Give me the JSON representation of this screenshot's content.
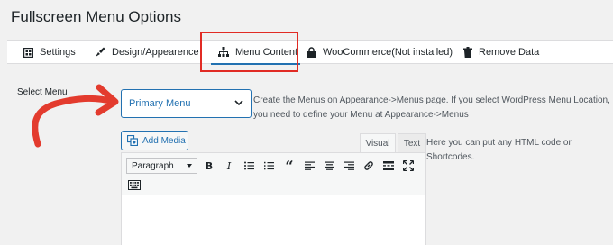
{
  "page": {
    "title": "Fullscreen Menu Options"
  },
  "tabs": [
    {
      "label": "Settings",
      "icon": "settings-grid-icon"
    },
    {
      "label": "Design/Appearence",
      "icon": "brush-icon"
    },
    {
      "label": "Menu Content",
      "icon": "sitemap-icon"
    },
    {
      "label": "WooCommerce(Not installed)",
      "icon": "lock-icon"
    },
    {
      "label": "Remove Data",
      "icon": "trash-icon"
    }
  ],
  "form": {
    "select_label": "Select Menu",
    "select_value": "Primary Menu",
    "help_text": "Create the Menus on Appearance->Menus page. If you select WordPress Menu Location, you need to define your Menu at Appearance->Menus",
    "editor_help": "Here you can put any HTML code or Shortcodes."
  },
  "editor": {
    "add_media": "Add Media",
    "tab_visual": "Visual",
    "tab_text": "Text",
    "format": "Paragraph",
    "toolbar_icons": [
      "bold-icon",
      "italic-icon",
      "bullet-list-icon",
      "numbered-list-icon",
      "blockquote-icon",
      "align-left-icon",
      "align-center-icon",
      "align-right-icon",
      "link-icon",
      "read-more-icon",
      "fullscreen-icon",
      "keyboard-icon"
    ]
  },
  "colors": {
    "accent": "#2271b1",
    "highlight": "#e12b24",
    "arrow": "#e33b2e"
  }
}
